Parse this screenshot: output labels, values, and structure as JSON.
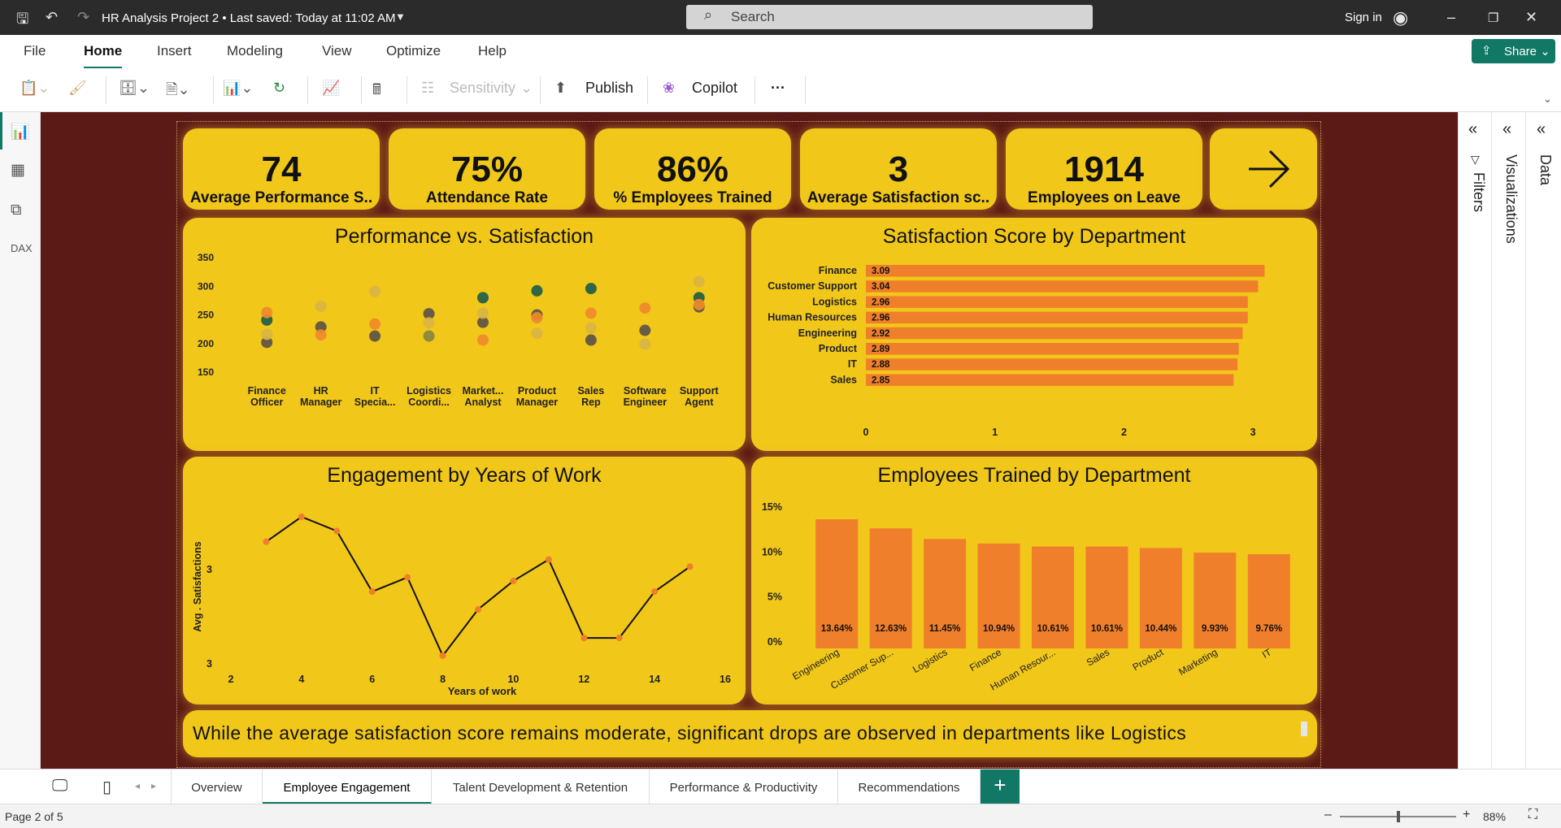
{
  "titlebar": {
    "title": "HR Analysis Project 2 • Last saved: Today at 11:02 AM",
    "search_placeholder": "Search",
    "signin": "Sign in"
  },
  "menu": {
    "file": "File",
    "home": "Home",
    "insert": "Insert",
    "modeling": "Modeling",
    "view": "View",
    "optimize": "Optimize",
    "help": "Help",
    "share": "Share"
  },
  "ribbon": {
    "sensitivity": "Sensitivity",
    "publish": "Publish",
    "copilot": "Copilot",
    "more": "···"
  },
  "kpis": [
    {
      "value": "74",
      "label": "Average Performance S.."
    },
    {
      "value": "75%",
      "label": "Attendance Rate"
    },
    {
      "value": "86%",
      "label": "% Employees Trained"
    },
    {
      "value": "3",
      "label": "Average Satisfaction sc.."
    },
    {
      "value": "1914",
      "label": "Employees on Leave"
    }
  ],
  "charts": {
    "scatter_title": "Performance vs. Satisfaction",
    "bar_title": "Satisfaction Score by Department",
    "line_title": "Engagement by Years of Work",
    "col_title": "Employees Trained by Department"
  },
  "chart_data": [
    {
      "type": "scatter",
      "title": "Performance vs. Satisfaction",
      "categories": [
        [
          "Finance",
          "Officer"
        ],
        [
          "HR",
          "Manager"
        ],
        [
          "IT",
          "Specia..."
        ],
        [
          "Logistics",
          "Coordi..."
        ],
        [
          "Market...",
          "Analyst"
        ],
        [
          "Product",
          "Manager"
        ],
        [
          "Sales",
          "Rep"
        ],
        [
          "Software",
          "Engineer"
        ],
        [
          "Support",
          "Agent"
        ]
      ],
      "yticks": [
        150,
        200,
        250,
        300,
        350
      ],
      "ylim": [
        150,
        360
      ],
      "series": [
        {
          "color": "#1f5c4a",
          "values": [
            241,
            null,
            null,
            null,
            280,
            292,
            296,
            null,
            280
          ]
        },
        {
          "color": "#5c5346",
          "values": [
            202,
            229,
            213,
            252,
            237,
            250,
            206,
            223,
            264
          ]
        },
        {
          "color": "#f08a2a",
          "values": [
            254,
            215,
            234,
            null,
            206,
            245,
            253,
            262,
            268
          ]
        },
        {
          "color": "#d9b443",
          "values": [
            216,
            265,
            291,
            236,
            253,
            218,
            227,
            199,
            308
          ]
        },
        {
          "color": "#8a8440",
          "values": [
            null,
            null,
            null,
            213,
            null,
            null,
            null,
            null,
            null
          ]
        }
      ]
    },
    {
      "type": "bar",
      "title": "Satisfaction Score by Department",
      "categories": [
        "Finance",
        "Customer Support",
        "Logistics",
        "Human Resources",
        "Engineering",
        "Product",
        "IT",
        "Sales"
      ],
      "values": [
        3.09,
        3.04,
        2.96,
        2.96,
        2.92,
        2.89,
        2.88,
        2.85
      ],
      "labels": [
        "3.09",
        "3.04",
        "2.96",
        "2.96",
        "2.92",
        "2.89",
        "2.88",
        "2.85"
      ],
      "xticks": [
        "0",
        "1",
        "2",
        "3"
      ],
      "xlim": [
        0,
        3.1
      ]
    },
    {
      "type": "line",
      "title": "Engagement by Years of Work",
      "x": [
        3,
        4,
        5,
        6,
        7,
        8,
        9,
        10,
        11,
        12,
        13,
        14,
        15
      ],
      "y": [
        3.18,
        3.25,
        3.21,
        3.04,
        3.08,
        2.86,
        2.99,
        3.07,
        3.13,
        2.91,
        2.91,
        3.04,
        3.11
      ],
      "xticks": [
        "2",
        "4",
        "6",
        "8",
        "10",
        "12",
        "14",
        "16"
      ],
      "xlim": [
        2,
        16
      ],
      "yticks": [
        "3",
        "3"
      ],
      "xlabel": "Years of work",
      "ylabel": "Avg . Satisfactions"
    },
    {
      "type": "bar",
      "title": "Employees Trained by Department",
      "categories": [
        "Engineering",
        "Customer Sup...",
        "Logistics",
        "Finance",
        "Human Resour...",
        "Sales",
        "Product",
        "Marketing",
        "IT"
      ],
      "values": [
        13.64,
        12.63,
        11.45,
        10.94,
        10.61,
        10.61,
        10.44,
        9.93,
        9.76
      ],
      "labels": [
        "13.64%",
        "12.63%",
        "11.45%",
        "10.94%",
        "10.61%",
        "10.61%",
        "10.44%",
        "9.93%",
        "9.76%"
      ],
      "yticks": [
        "0%",
        "5%",
        "10%",
        "15%"
      ],
      "ylim": [
        0,
        15
      ]
    }
  ],
  "insight": "While the average satisfaction score remains moderate, significant drops are observed in departments like Logistics",
  "rightpane": {
    "filters": "Filters",
    "visualizations": "Visualizations",
    "data": "Data"
  },
  "tabs": [
    "Overview",
    "Employee Engagement",
    "Talent Development & Retention",
    "Performance & Productivity",
    "Recommendations"
  ],
  "status": {
    "page": "Page 2 of 5",
    "zoom": "88%"
  },
  "colors": {
    "accent": "#117865",
    "card": "#f1c71a",
    "bar": "#f07f2b",
    "canvas": "#5b1a16"
  }
}
